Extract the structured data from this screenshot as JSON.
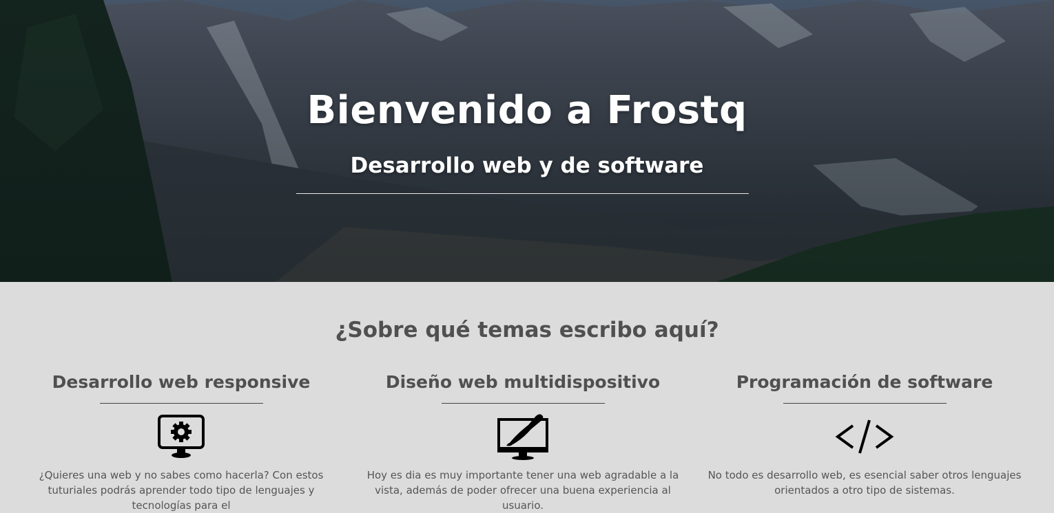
{
  "hero": {
    "title": "Bienvenido a Frostq",
    "subtitle": "Desarrollo web y de software"
  },
  "topics": {
    "heading": "¿Sobre qué temas escribo aquí?",
    "items": [
      {
        "title": "Desarrollo web responsive",
        "icon": "monitor-gear-icon",
        "text": "¿Quieres una web y no sabes como hacerla? Con estos tuturiales podrás aprender todo tipo de lenguajes y tecnologías para el"
      },
      {
        "title": "Diseño web multidispositivo",
        "icon": "monitor-brush-icon",
        "text": "Hoy es dia es muy importante tener una web agradable a la vista, además de poder ofrecer una buena experiencia al usuario."
      },
      {
        "title": "Programación de software",
        "icon": "code-icon",
        "text": "No todo es desarrollo web, es esencial saber otros lenguajes orientados a otro tipo de sistemas."
      }
    ]
  },
  "colors": {
    "section_bg": "#dcdcdc",
    "heading_text": "#505050",
    "hero_text": "#ffffff"
  }
}
